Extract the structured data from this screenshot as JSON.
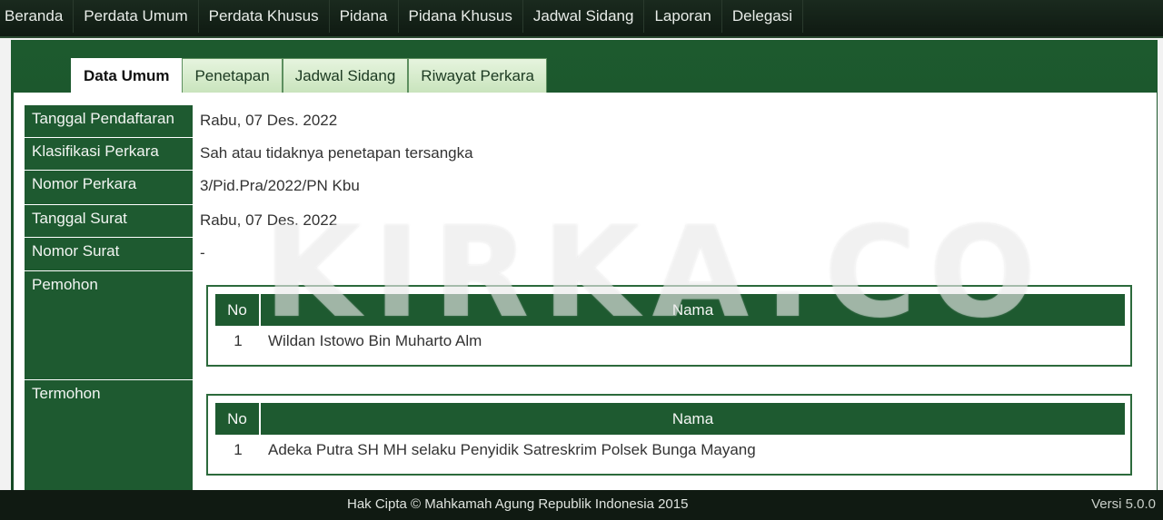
{
  "nav": {
    "items": [
      "Beranda",
      "Perdata Umum",
      "Perdata Khusus",
      "Pidana",
      "Pidana Khusus",
      "Jadwal Sidang",
      "Laporan",
      "Delegasi"
    ]
  },
  "tabs": [
    "Data Umum",
    "Penetapan",
    "Jadwal Sidang",
    "Riwayat Perkara"
  ],
  "active_tab": "Data Umum",
  "details": [
    {
      "label": "Tanggal Pendaftaran",
      "value": "Rabu, 07 Des. 2022"
    },
    {
      "label": "Klasifikasi Perkara",
      "value": "Sah atau tidaknya penetapan tersangka"
    },
    {
      "label": "Nomor Perkara",
      "value": "3/Pid.Pra/2022/PN Kbu"
    },
    {
      "label": "Tanggal Surat",
      "value": "Rabu, 07 Des. 2022"
    },
    {
      "label": "Nomor Surat",
      "value": "-"
    }
  ],
  "pemohon": {
    "label": "Pemohon",
    "col_no": "No",
    "col_nama": "Nama",
    "rows": [
      {
        "no": "1",
        "nama": "Wildan Istowo Bin Muharto Alm"
      }
    ]
  },
  "termohon": {
    "label": "Termohon",
    "col_no": "No",
    "col_nama": "Nama",
    "rows": [
      {
        "no": "1",
        "nama": "Adeka Putra SH MH selaku Penyidik Satreskrim Polsek Bunga Mayang"
      }
    ]
  },
  "watermark": "KIRKA.CO",
  "footer": {
    "copyright": "Hak Cipta © Mahkamah Agung Republik Indonesia 2015",
    "version": "Versi 5.0.0"
  },
  "colors": {
    "primary_green": "#1e5a30",
    "nav_dark": "#0f1a12",
    "tab_light": "#c9e4bd"
  }
}
